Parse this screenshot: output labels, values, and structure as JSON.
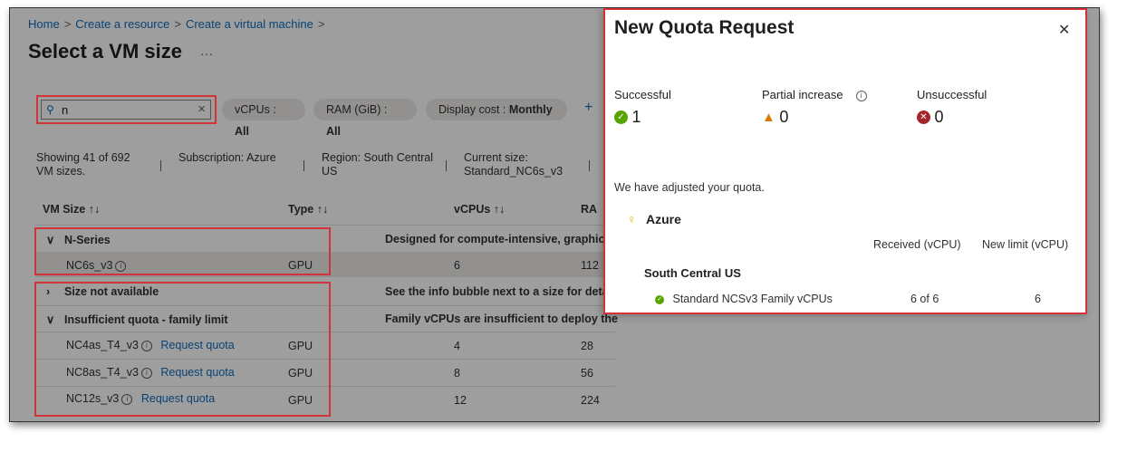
{
  "breadcrumb": [
    "Home",
    "Create a resource",
    "Create a virtual machine"
  ],
  "page_title": "Select a VM size",
  "more_label": "···",
  "search": {
    "value": "n"
  },
  "filters": [
    {
      "key": "vCPUs : ",
      "value": "All"
    },
    {
      "key": "RAM (GiB) : ",
      "value": "All"
    },
    {
      "key": "Display cost : ",
      "value": "Monthly"
    }
  ],
  "summary": {
    "showing_line1": "Showing 41 of 692",
    "showing_line2": "VM sizes.",
    "subscription": "Subscription: Azure",
    "region_line1": "Region: South Central",
    "region_line2": "US",
    "current_line1": "Current size:",
    "current_line2": "Standard_NC6s_v3"
  },
  "columns": [
    "VM Size",
    "Type",
    "vCPUs",
    "RA"
  ],
  "sort_glyph": "↑↓",
  "groups": {
    "nseries": {
      "label": "N-Series",
      "desc": "Designed for compute-intensive, graphics"
    },
    "not_available": {
      "label": "Size not available",
      "desc": "See the info bubble next to a size for deta"
    },
    "insufficient": {
      "label": "Insufficient quota - family limit",
      "desc": "Family vCPUs are insufficient to deploy the"
    }
  },
  "rows": [
    {
      "name": "NC6s_v3",
      "type": "GPU",
      "vcpus": "6",
      "ram": "112"
    },
    {
      "name": "NC4as_T4_v3",
      "link": "Request quota",
      "type": "GPU",
      "vcpus": "4",
      "ram": "28"
    },
    {
      "name": "NC8as_T4_v3",
      "link": "Request quota",
      "type": "GPU",
      "vcpus": "8",
      "ram": "56"
    },
    {
      "name": "NC12s_v3",
      "link": "Request quota",
      "type": "GPU",
      "vcpus": "12",
      "ram": "224"
    }
  ],
  "quota": {
    "title": "New Quota Request",
    "close": "✕",
    "successful": {
      "label": "Successful",
      "count": "1"
    },
    "partial": {
      "label": "Partial increase",
      "count": "0"
    },
    "unsuccessful": {
      "label": "Unsuccessful",
      "count": "0"
    },
    "message": "We have adjusted your quota.",
    "subscription": "Azure",
    "col_received": "Received (vCPU)",
    "col_newlimit": "New limit (vCPU)",
    "region": "South Central US",
    "family": "Standard NCSv3 Family vCPUs",
    "received": "6 of 6",
    "new_limit": "6"
  },
  "colors": {
    "accent": "#0f6cbd",
    "success": "#57a300",
    "warning": "#d87b00",
    "error": "#a4262c",
    "highlight": "#d13438"
  }
}
